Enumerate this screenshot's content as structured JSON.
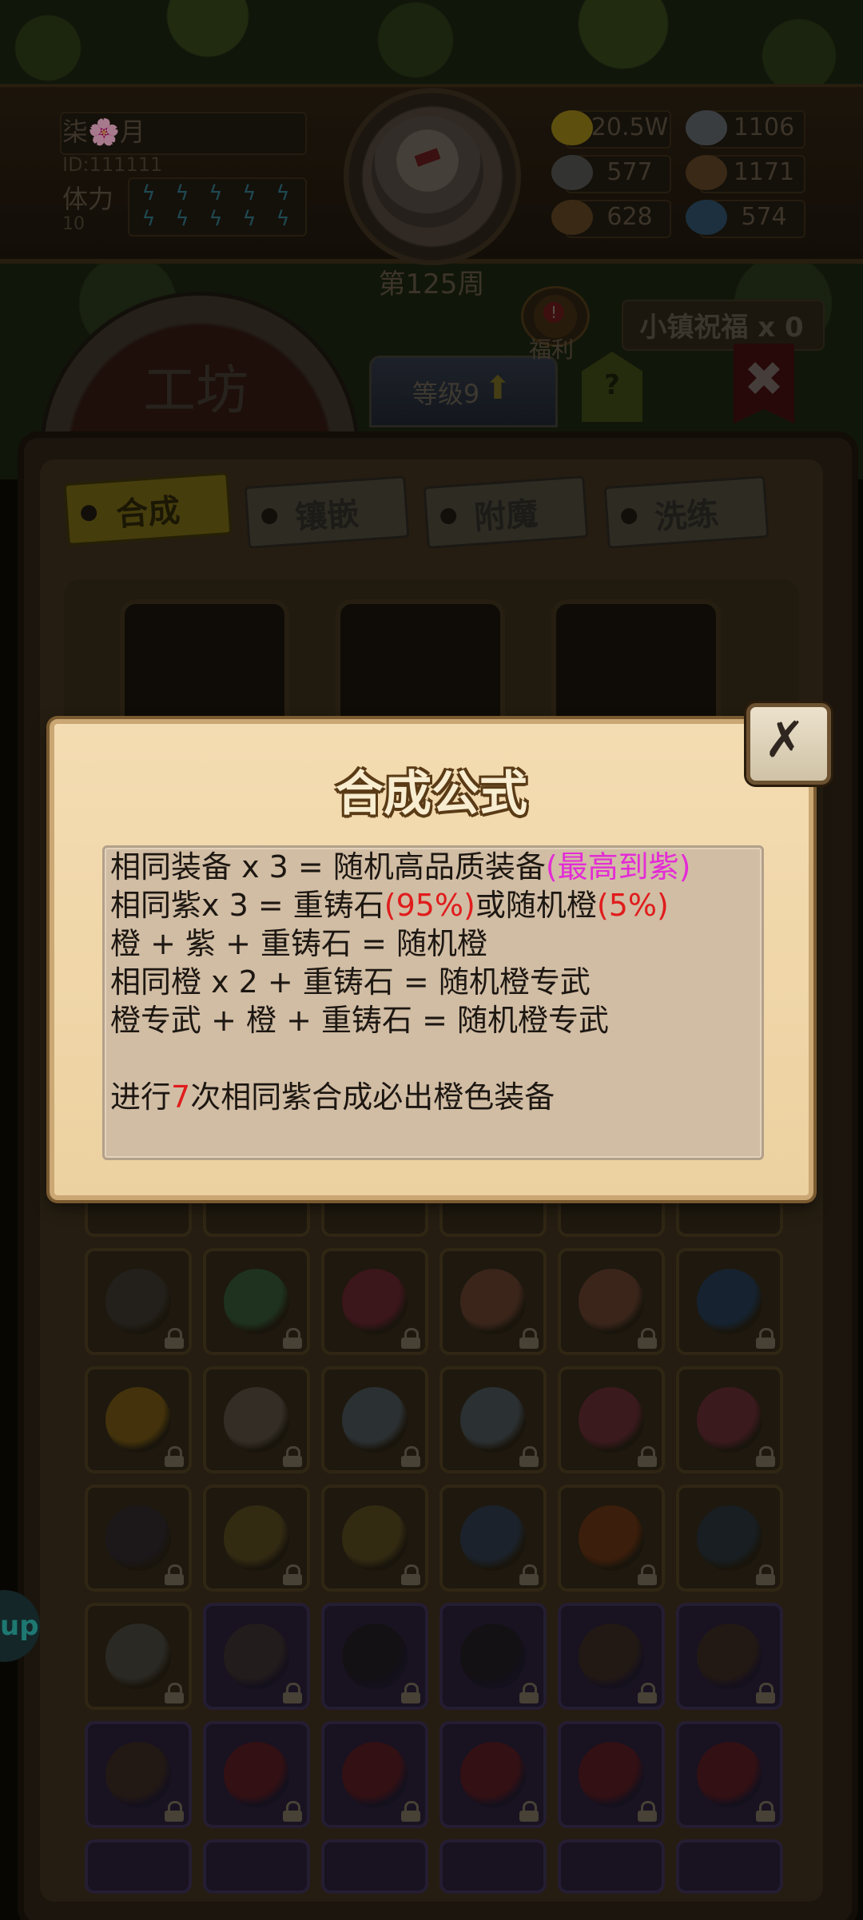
{
  "header": {
    "player_name": "柒🌸月",
    "player_id": "ID:111111",
    "stamina_label": "体力",
    "stamina_value": "10",
    "week_label": "第125周",
    "resources": [
      {
        "icon": "gold-coin-icon",
        "value": "20.5W",
        "color": "#8f7a16"
      },
      {
        "icon": "iron-ingot-icon",
        "value": "1106",
        "color": "#5a5f63"
      },
      {
        "icon": "stone-ore-icon",
        "value": "577",
        "color": "#4f514e"
      },
      {
        "icon": "leather-hide-icon",
        "value": "1171",
        "color": "#5a3f22"
      },
      {
        "icon": "wood-log-icon",
        "value": "628",
        "color": "#5a4020"
      },
      {
        "icon": "blue-crystal-icon",
        "value": "574",
        "color": "#2c4a62"
      }
    ]
  },
  "workshop": {
    "title": "工坊",
    "level_label": "等级9",
    "help_icon": "?",
    "welfare_label": "福利",
    "welfare_alert": "!",
    "blessing_label": "小镇祝福 x 0",
    "close_icon": "✖"
  },
  "tabs": [
    {
      "label": "合成",
      "active": true
    },
    {
      "label": "镶嵌",
      "active": false
    },
    {
      "label": "附魔",
      "active": false
    },
    {
      "label": "洗练",
      "active": false
    }
  ],
  "side_bubble_text": "up",
  "dialog": {
    "title": "合成公式",
    "close_icon": "✗",
    "rules": [
      [
        {
          "t": "相同装备 x 3 = 随机高品质装备",
          "c": ""
        },
        {
          "t": "(最高到紫)",
          "c": "pink"
        }
      ],
      [
        {
          "t": "相同紫x 3 = 重铸石",
          "c": ""
        },
        {
          "t": "(95%)",
          "c": "red"
        },
        {
          "t": "或随机橙",
          "c": ""
        },
        {
          "t": "(5%)",
          "c": "red"
        }
      ],
      [
        {
          "t": "橙 + 紫 + 重铸石 = 随机橙",
          "c": ""
        }
      ],
      [
        {
          "t": "相同橙 x 2 + 重铸石 = 随机橙专武",
          "c": ""
        }
      ],
      [
        {
          "t": "橙专武 + 橙 + 重铸石 = 随机橙专武",
          "c": ""
        }
      ],
      [
        {
          "t": "",
          "c": ""
        }
      ],
      [
        {
          "t": "进行",
          "c": ""
        },
        {
          "t": "7",
          "c": "red"
        },
        {
          "t": "次相同紫合成必出橙色装备",
          "c": ""
        }
      ]
    ]
  },
  "inventory": {
    "rows": [
      [
        {
          "name": "shield-item",
          "color": "#3a3632",
          "purple": false
        },
        {
          "name": "emerald-ring-item",
          "color": "#2f5a3a",
          "purple": false
        },
        {
          "name": "battle-axe-item",
          "color": "#6a2030",
          "purple": false
        },
        {
          "name": "voodoo-doll-item",
          "color": "#6a4030",
          "purple": false
        },
        {
          "name": "voodoo-doll-item",
          "color": "#6a4030",
          "purple": false
        },
        {
          "name": "knight-helmet-item",
          "color": "#1e3a5a",
          "purple": false
        }
      ],
      [
        {
          "name": "dragon-ring-item",
          "color": "#7a5a10",
          "purple": false
        },
        {
          "name": "skull-staff-item",
          "color": "#5a5048",
          "purple": false
        },
        {
          "name": "crystal-sword-item",
          "color": "#4a5660",
          "purple": false
        },
        {
          "name": "crystal-sword-item",
          "color": "#4a5660",
          "purple": false
        },
        {
          "name": "claw-hook-item",
          "color": "#6a2836",
          "purple": false
        },
        {
          "name": "claw-hook-item",
          "color": "#6a2836",
          "purple": false
        }
      ],
      [
        {
          "name": "gauntlet-item",
          "color": "#2a2430",
          "purple": false
        },
        {
          "name": "royal-armor-item",
          "color": "#5a4a20",
          "purple": false
        },
        {
          "name": "royal-armor-item",
          "color": "#5a4a20",
          "purple": false
        },
        {
          "name": "steel-claw-item",
          "color": "#2a3a52",
          "purple": false
        },
        {
          "name": "flame-sword-item",
          "color": "#6a3010",
          "purple": false
        },
        {
          "name": "spyglass-item",
          "color": "#22323e",
          "purple": false
        }
      ],
      [
        {
          "name": "potion-flask-item",
          "color": "#4a4844",
          "purple": false
        },
        {
          "name": "whip-item",
          "color": "#3a3028",
          "purple": true
        },
        {
          "name": "dark-armor-item",
          "color": "#1e1a1a",
          "purple": true
        },
        {
          "name": "dark-armor-item",
          "color": "#1e1a1a",
          "purple": true
        },
        {
          "name": "fang-necklace-item",
          "color": "#3a2a18",
          "purple": true
        },
        {
          "name": "fang-necklace-item",
          "color": "#3a2a18",
          "purple": true
        }
      ],
      [
        {
          "name": "fang-necklace-item",
          "color": "#3a2a18",
          "purple": true
        },
        {
          "name": "red-scarf-item",
          "color": "#5a1818",
          "purple": true
        },
        {
          "name": "red-scarf-item",
          "color": "#5a1818",
          "purple": true
        },
        {
          "name": "red-scarf-item",
          "color": "#5a1818",
          "purple": true
        },
        {
          "name": "red-scarf-item",
          "color": "#5a1818",
          "purple": true
        },
        {
          "name": "red-scarf-item",
          "color": "#5a1818",
          "purple": true
        }
      ]
    ]
  }
}
